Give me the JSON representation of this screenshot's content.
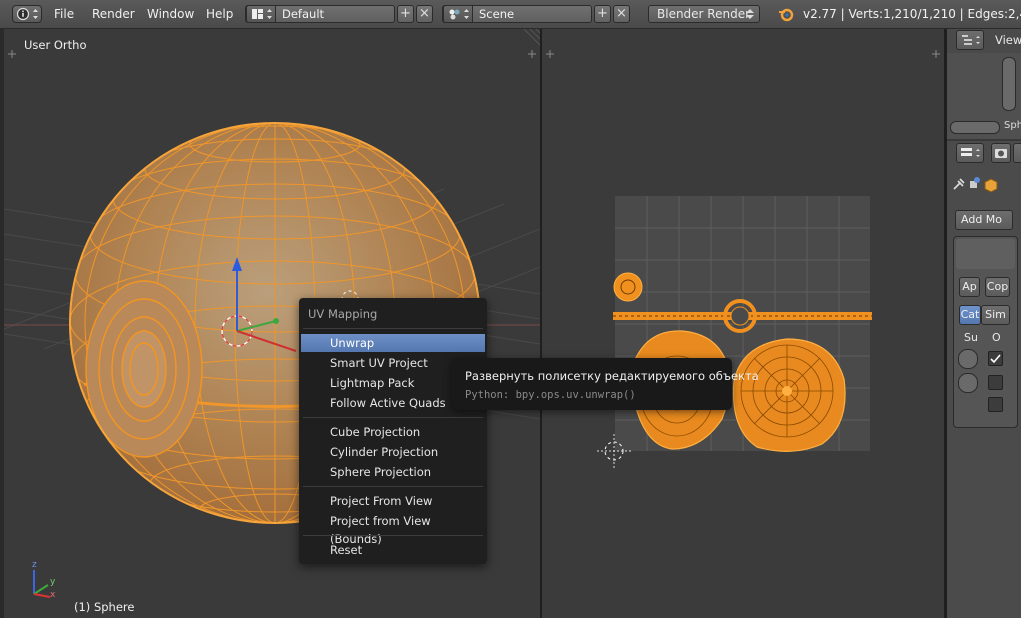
{
  "header": {
    "menus": [
      "File",
      "Render",
      "Window",
      "Help"
    ],
    "layout_name": "Default",
    "scene_name": "Scene",
    "render_engine": "Blender Render",
    "stats": "v2.77 | Verts:1,210/1,210 | Edges:2,448/2,"
  },
  "viewport3d": {
    "view_label": "User Ortho",
    "object_label": "(1) Sphere",
    "axis_labels": {
      "x": "x",
      "y": "y",
      "z": "z"
    }
  },
  "uv_menu": {
    "title": "UV Mapping",
    "items": [
      {
        "label": "Unwrap",
        "active": true
      },
      {
        "label": "Smart UV Project"
      },
      {
        "label": "Lightmap Pack"
      },
      {
        "label": "Follow Active Quads"
      },
      {
        "label": "Cube Projection"
      },
      {
        "label": "Cylinder Projection"
      },
      {
        "label": "Sphere Projection"
      },
      {
        "label": "Project From View"
      },
      {
        "label": "Project from View (Bounds)"
      },
      {
        "label": "Reset"
      }
    ]
  },
  "tooltip": {
    "description": "Развернуть полисетку редактируемого объекта",
    "python": "Python: bpy.ops.uv.unwrap()"
  },
  "outliner": {
    "view_label": "View",
    "item_label": "Sph"
  },
  "properties": {
    "add_modifier": "Add Mo",
    "apply": "Ap",
    "copy": "Cop",
    "catmull": "Cat",
    "simple": "Sim",
    "col_su": "Su",
    "col_o": "O"
  },
  "colors": {
    "selection_orange": "#f58a1f",
    "menu_highlight": "#5b7fbd",
    "viewport_bg": "#3a3a3a"
  }
}
